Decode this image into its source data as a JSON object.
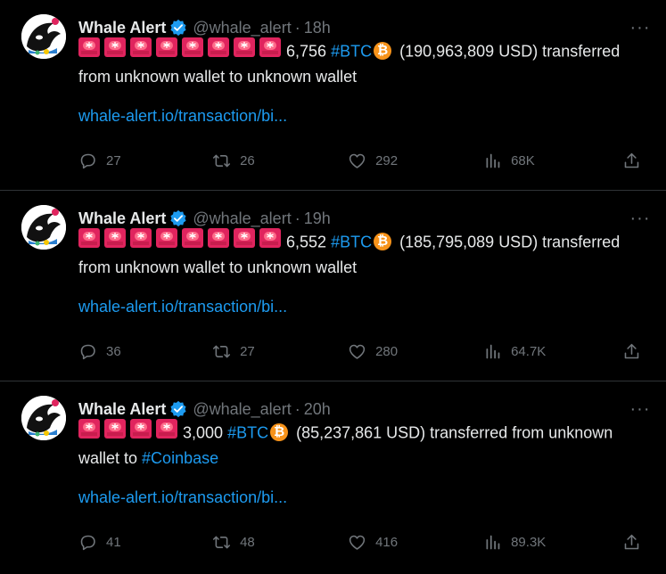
{
  "tweets": [
    {
      "author": "Whale Alert",
      "handle": "@whale_alert",
      "time": "18h",
      "siren_count": 8,
      "amount": "6,756",
      "hashtag": "#BTC",
      "usd": "(190,963,809 USD) transferred",
      "line2": "from unknown wallet to unknown wallet",
      "line2_hashtag": "",
      "link": "whale-alert.io/transaction/bi...",
      "replies": "27",
      "retweets": "26",
      "likes": "292",
      "views": "68K"
    },
    {
      "author": "Whale Alert",
      "handle": "@whale_alert",
      "time": "19h",
      "siren_count": 8,
      "amount": "6,552",
      "hashtag": "#BTC",
      "usd": "(185,795,089 USD) transferred",
      "line2": "from unknown wallet to unknown wallet",
      "line2_hashtag": "",
      "link": "whale-alert.io/transaction/bi...",
      "replies": "36",
      "retweets": "27",
      "likes": "280",
      "views": "64.7K"
    },
    {
      "author": "Whale Alert",
      "handle": "@whale_alert",
      "time": "20h",
      "siren_count": 4,
      "amount": "3,000",
      "hashtag": "#BTC",
      "usd": "(85,237,861 USD) transferred from unknown",
      "line2": "wallet to ",
      "line2_hashtag": "#Coinbase",
      "link": "whale-alert.io/transaction/bi...",
      "replies": "41",
      "retweets": "48",
      "likes": "416",
      "views": "89.3K"
    }
  ],
  "icons": {
    "verified": "verified-badge-icon",
    "siren": "police-siren-icon",
    "bitcoin": "bitcoin-icon",
    "reply": "reply-icon",
    "retweet": "retweet-icon",
    "like": "heart-icon",
    "views": "views-icon",
    "share": "share-icon",
    "more": "more-icon"
  },
  "colors": {
    "background": "#000000",
    "text": "#e7e9ea",
    "muted": "#71767b",
    "link": "#1d9bf0",
    "bitcoin": "#f7931a",
    "siren": "#e0245e"
  }
}
